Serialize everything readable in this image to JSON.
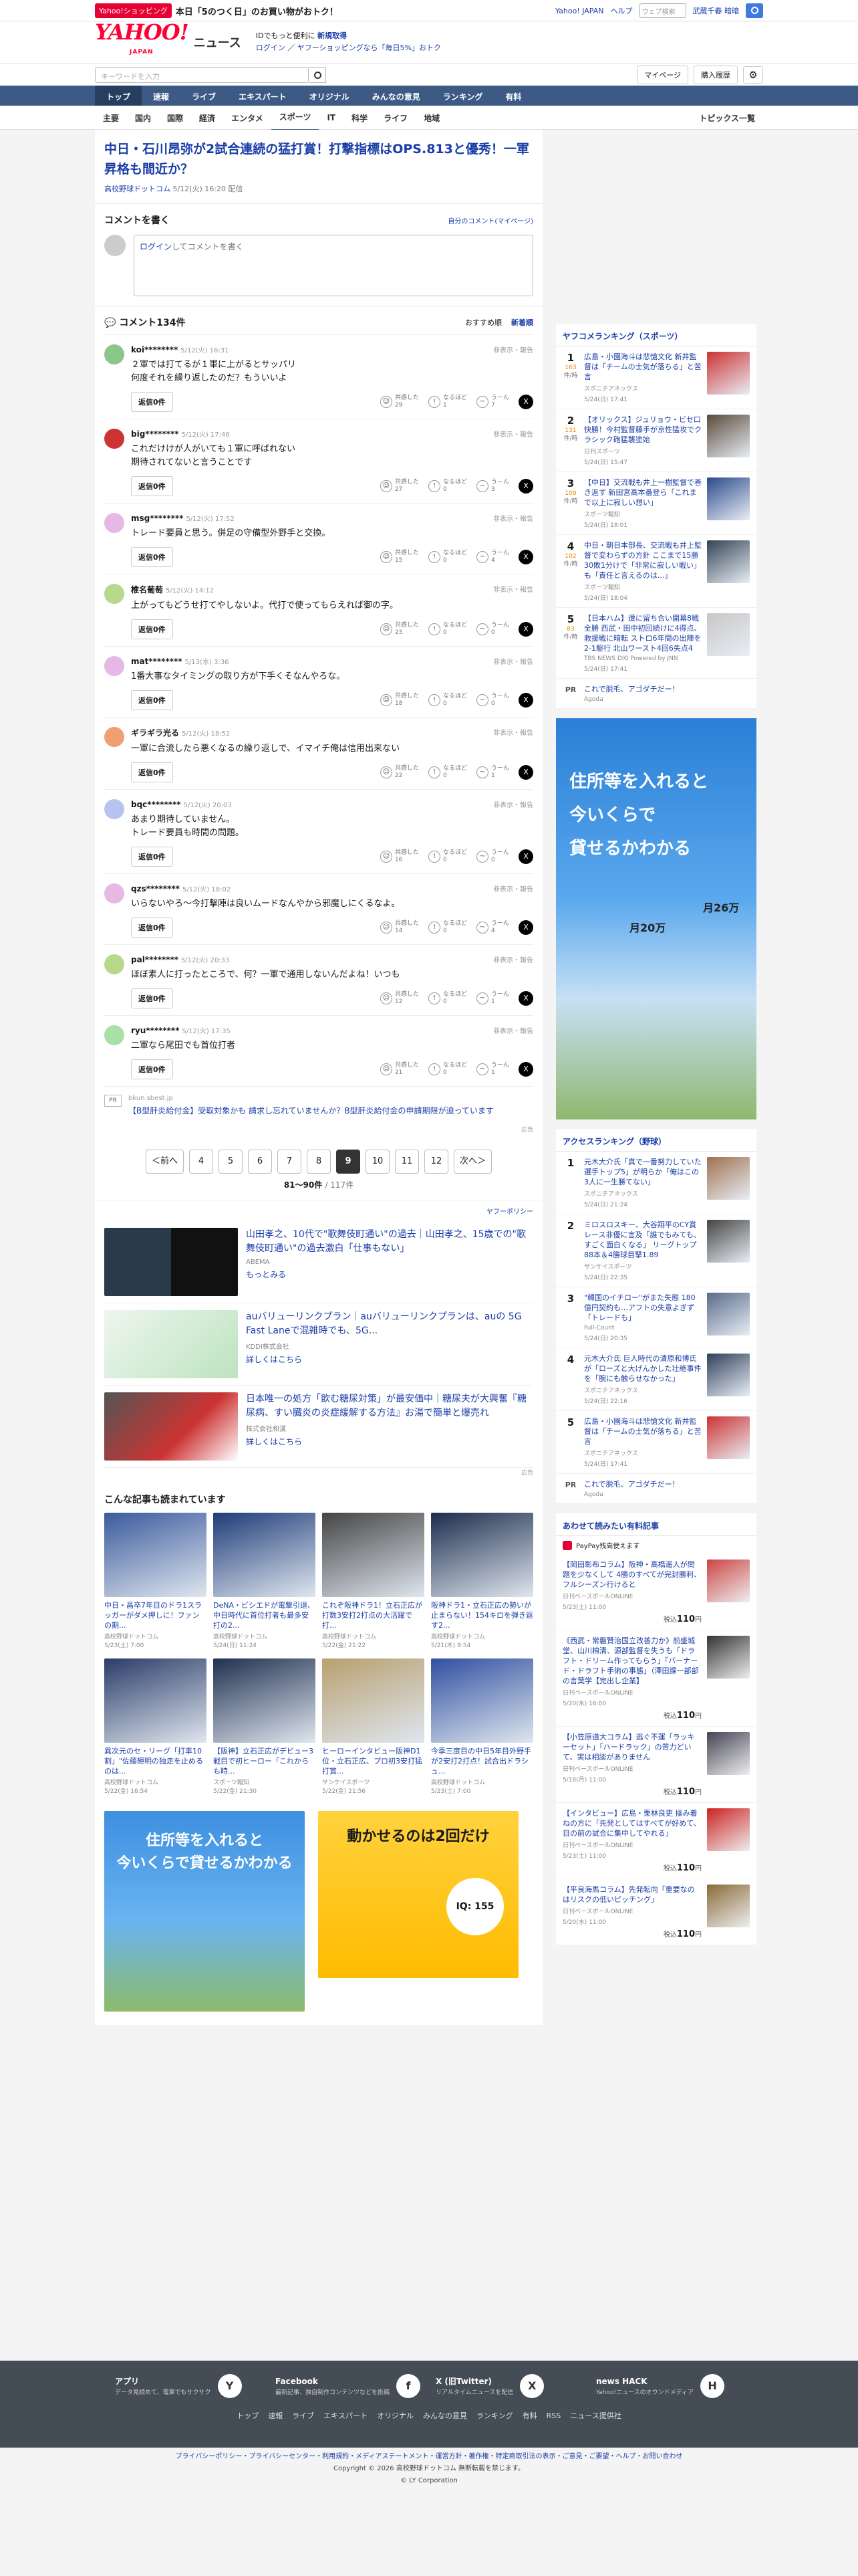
{
  "topbar": {
    "tag": "Yahoo!ショッピング",
    "promo": "本日「5のつく日」のお買い物がおトク！",
    "links": [
      "Yahoo! JAPAN",
      "ヘルプ"
    ],
    "web_placeholder": "ウェブ検索",
    "city": "武蔵千春 暗暗"
  },
  "header": {
    "logo": "YAHOO!",
    "logo_sub": "JAPAN",
    "title": "ニュース",
    "info1": "IDでもっと便利に",
    "info1b": "新規取得",
    "info2": "ログイン",
    "info2b": "ヤフーショッピングなら「毎日5%」おトク"
  },
  "search": {
    "placeholder": "キーワードを入力",
    "mypage": "マイページ",
    "history": "購入履歴"
  },
  "nav1": [
    "トップ",
    "速報",
    "ライブ",
    "エキスパート",
    "オリジナル",
    "みんなの意見",
    "ランキング",
    "有料"
  ],
  "nav2": [
    "主要",
    "国内",
    "国際",
    "経済",
    "エンタメ",
    "スポーツ",
    "IT",
    "科学",
    "ライフ",
    "地域"
  ],
  "nav2_topics": "トピックス一覧",
  "article": {
    "title": "中日・石川昂弥が2試合連続の猛打賞！打撃指標はOPS.813と優秀！一軍昇格も間近か？",
    "source": "高校野球ドットコム",
    "date": "5/12(火) 16:20 配信"
  },
  "comment_box": {
    "heading": "コメントを書く",
    "mine": "自分のコメント(マイページ)",
    "login": "ログイン",
    "placeholder": "してコメントを書く"
  },
  "comments_head": {
    "title": "コメント134件",
    "sort1": "おすすめ順",
    "sort2": "新着順"
  },
  "reply_label": "返信0件",
  "flag_label": "非表示・報告",
  "reactions": {
    "a": "共感した",
    "b": "なるほど",
    "c": "うーん"
  },
  "comments": [
    {
      "name": "koi********",
      "date": "5/12(火) 16:31",
      "text": "２軍では打てるが１軍に上がるとサッパリ\n何度それを繰り返したのだ？もういいよ",
      "a": "29",
      "b": "1",
      "c": "7",
      "color": "#8bc68b"
    },
    {
      "name": "big********",
      "date": "5/12(火) 17:46",
      "text": "これだけけが人がいても１軍に呼ばれない\n期待されてないと言うことです",
      "a": "27",
      "b": "0",
      "c": "3",
      "color": "#c33"
    },
    {
      "name": "msg********",
      "date": "5/12(火) 17:52",
      "text": "トレード要員と思う。併足の守備型外野手と交換。",
      "a": "15",
      "b": "0",
      "c": "4",
      "color": "#e6b8e6"
    },
    {
      "name": "椎名葡萄",
      "date": "5/12(火) 14:12",
      "text": "上がってもどうせ打てやしないよ。代打で使ってもらえれば御の字。",
      "a": "23",
      "b": "0",
      "c": "0",
      "color": "#b8d98b"
    },
    {
      "name": "mat********",
      "date": "5/13(水) 3:36",
      "text": "1番大事なタイミングの取り方が下手くそなんやろな。",
      "a": "18",
      "b": "0",
      "c": "0",
      "color": "#e6b8e6"
    },
    {
      "name": "ギラギラ光る",
      "date": "5/12(火) 18:52",
      "text": "一軍に合流したら悪くなるの繰り返しで、イマイチ俺は信用出来ない",
      "a": "22",
      "b": "0",
      "c": "1",
      "color": "#f0a070"
    },
    {
      "name": "bqc********",
      "date": "5/12(火) 20:03",
      "text": "あまり期待していません。\nトレード要員も時間の問題。",
      "a": "16",
      "b": "0",
      "c": "0",
      "color": "#b8c4f0"
    },
    {
      "name": "qzs********",
      "date": "5/12(火) 18:02",
      "text": "いらないやろ〜今打撃陣は良いムードなんやから邪魔しにくるなよ。",
      "a": "14",
      "b": "0",
      "c": "4",
      "color": "#e6b8e6"
    },
    {
      "name": "pal********",
      "date": "5/12(火) 20:33",
      "text": "ほぼ素人に打ったところで、何？一軍で通用しないんだよね！いつも",
      "a": "12",
      "b": "0",
      "c": "1",
      "color": "#b8d98b"
    },
    {
      "name": "ryu********",
      "date": "5/12(火) 17:35",
      "text": "二軍なら尾田でも首位打者",
      "a": "21",
      "b": "0",
      "c": "1",
      "color": "#a8e0a8"
    }
  ],
  "inline_ad": {
    "badge": "PR",
    "site": "bkun.sbest.jp",
    "title": "【B型肝炎給付金】受取対象かも 請求し忘れていませんか？B型肝炎給付金の申請期限が迫っています",
    "note": "広告"
  },
  "pager": {
    "prev": "＜前へ",
    "pages": [
      "4",
      "5",
      "6",
      "7",
      "8",
      "9",
      "10",
      "11",
      "12"
    ],
    "current": "9",
    "next": "次へ＞",
    "count": "81〜90件",
    "total": "/ 117件"
  },
  "promos": {
    "policy": "ヤフーポリシー",
    "items": [
      {
        "title": "山田孝之、10代で\"歌舞伎町通い\"の過去｜山田孝之、15歳での\"歌舞伎町通い\"の過去激白「仕事もない」",
        "src": "ABEMA",
        "more": "もっとみる"
      },
      {
        "title": "auバリューリンクプラン｜auバリューリンクプランは、auの 5G Fast Laneで混雑時でも、5G...",
        "src": "KDDI株式会社",
        "more": "詳しくはこちら"
      },
      {
        "title": "日本唯一の処方「飲む糖尿対策」が最安価中｜糖尿夫が大興奮『糖尿病、すい臓炎の炎症緩解する方法』お湯で簡単と爆売れ",
        "src": "株式会社和漢",
        "more": "詳しくはこちら"
      }
    ]
  },
  "related": {
    "heading": "こんな記事も読まれています",
    "items": [
      {
        "t": "中日・昌卒7年目のドラ1スラッガーがダメ押しに！ファンの期...",
        "s": "高校野球ドットコム",
        "d": "5/23(土) 7:00",
        "c": "#3a5a9c"
      },
      {
        "t": "DeNA・ビシエドが電撃引退、中日時代に首位打者も最多安打の2...",
        "s": "高校野球ドットコム",
        "d": "5/24(日) 11:24",
        "c": "#1e3c78"
      },
      {
        "t": "これぞ阪神ドラ1！立石正広が打数3安打2打点の大活躍で打...",
        "s": "高校野球ドットコム",
        "d": "5/22(金) 21:22",
        "c": "#444"
      },
      {
        "t": "阪神ドラ1・立石正広の勢いが止まらない！154キロを弾き返す2...",
        "s": "高校野球ドットコム",
        "d": "5/21(木) 9:54",
        "c": "#1c2c4c"
      },
      {
        "t": "異次元のセ・リーグ「打率10割」\"佐藤輝明の独走を止めるのは...",
        "s": "高校野球ドットコム",
        "d": "5/22(金) 16:54",
        "c": "#2a3c68"
      },
      {
        "t": "【阪神】立石正広がデビュー3戦目で初ヒーロー「これからも時...",
        "s": "スポーツ報知",
        "d": "5/22(金) 21:30",
        "c": "#203050"
      },
      {
        "t": "ヒーローインタビュー阪神D1位・立石正広、プロ初3安打猛打賞...",
        "s": "サンケイスポーツ",
        "d": "5/22(金) 21:56",
        "c": "#b8a070"
      },
      {
        "t": "今季三度目の中日5年目外野手が2安打2打点！試合出ドラシュ...",
        "s": "高校野球ドットコム",
        "d": "5/23(土) 7:00",
        "c": "#3050a0"
      }
    ]
  },
  "bottom_ads": {
    "a": "住所等を入れると\n今いくらで貸せるかわかる",
    "b": "動かせるのは2回だけ",
    "iq": "IQ: 155"
  },
  "rank1": {
    "title": "ヤフコメランキング（スポーツ）",
    "items": [
      {
        "no": "1",
        "cnt": "163",
        "unit": "件/時",
        "t": "広島・小園海斗は悲愴文化 新井監督は「チームの士気が落ちる」と苦言",
        "s": "スポニチアネックス",
        "d": "5/24(日) 17:41",
        "c": "#c33"
      },
      {
        "no": "2",
        "cnt": "131",
        "unit": "件/時",
        "t": "【オリックス】ジュリョウ・ビセ口快勝！今村監督藤手が京性猛攻でクラシック砲猛襲塗始",
        "s": "日刊スポーツ",
        "d": "5/24(日) 15:47",
        "c": "#5a4a3a"
      },
      {
        "no": "3",
        "cnt": "109",
        "unit": "件/時",
        "t": "【中日】交流戦も井上一樹監督で巻き返す 新田宮高本番登ら「これまで以上に寂しい想い」",
        "s": "スポーツ報知",
        "d": "5/24(日) 18:01",
        "c": "#2a4a8a"
      },
      {
        "no": "4",
        "cnt": "102",
        "unit": "件/時",
        "t": "中日・朝日本部長、交流戦も井上監督で変わらずの方針 ここまで15勝30敗1分けで「非常に寂しい戦い」も「責任と言えるのは…」",
        "s": "スポーツ報知",
        "d": "5/24(日) 18:04",
        "c": "#345"
      },
      {
        "no": "5",
        "cnt": "83",
        "unit": "件/時",
        "t": "【日本ハム】遭に留ち合い開幕8戦全勝 西武・田中初回続けに4得点、救援戦に暗転 ストロ6年間の出陣を2-1駆行 北山ワースト4回6失点4",
        "s": "TBS NEWS DIG Powered by JNN",
        "d": "5/24(日) 17:41",
        "c": "#c7c7c7"
      }
    ],
    "pr_label": "PR",
    "pr_title": "これで脱毛、アゴダチだー！",
    "pr_src": "Agoda"
  },
  "side_ad": {
    "title": "住所等を入れると\n今いくらで\n貸せるかわかる",
    "price1": "月20万",
    "price2": "月26万"
  },
  "rank2": {
    "title": "アクセスランキング（野球）",
    "items": [
      {
        "no": "1",
        "t": "元木大介氏「真で一番努力していた選手トップ5」が明らか「俺はこの3人に一生勝てない」",
        "s": "スポニチアネックス",
        "d": "5/24(日) 21:24",
        "c": "#a07050"
      },
      {
        "no": "2",
        "t": "ミロスロスキー、大谷翔平のCY賞レース非優に言及「誰でもみても、すごく面白くなる」 リーグトップ88本＆4勝球目撃1.89",
        "s": "サンケイスポーツ",
        "d": "5/24(日) 22:35",
        "c": "#444"
      },
      {
        "no": "3",
        "t": "\"韓国のイチロー\"がまた失態 180億円契約も…アフトの失意よぎず「トレードも」",
        "s": "Full-Count",
        "d": "5/24(日) 20:35",
        "c": "#5a6a8a"
      },
      {
        "no": "4",
        "t": "元木大介氏 巨人時代の清原和博氏が「ローズと大げんかした壮絶事件を「腕にも触らせなかった」",
        "s": "スポニチアネックス",
        "d": "5/24(日) 22:16",
        "c": "#30405a"
      },
      {
        "no": "5",
        "t": "広島・小園海斗は悲愴文化 新井監督は「チームの士気が落ちる」と苦言",
        "s": "スポニチアネックス",
        "d": "5/24(日) 17:41",
        "c": "#c33"
      }
    ],
    "pr_label": "PR",
    "pr_title": "これで脱毛、アゴダチだー！",
    "pr_src": "Agoda"
  },
  "paid": {
    "title": "あわせて読みたい有料記事",
    "pp": "PayPay残高使えます",
    "items": [
      {
        "t": "【岡田彰布コラム】阪神・高橋遥人が問題を少なくして 4勝のすべてが完封勝利、フルシーズン行けると",
        "s": "日刊ベースボールONLINE",
        "d": "5/23(土) 11:00",
        "price": "110",
        "c": "#c44"
      },
      {
        "t": "《西武・常磐賢治国立改善力か》前盛城堂、山川棉清、源部監督を失うも「ドラフト・ドリーム作ってもらう」「バーナード・ドラフト手術の事態」（澤田課一部部の言葉学【完出し企業】",
        "s": "日刊ベースボールONLINE",
        "d": "5/20(水) 16:00",
        "price": "110",
        "c": "#333"
      },
      {
        "t": "【小笠原道大コラム】逃ぐ不運「ラッキーセット」「ハードラック」の苦力どいて、実は相談がありません",
        "s": "日刊ベースボールONLINE",
        "d": "5/18(月) 11:00",
        "price": "110",
        "c": "#445"
      },
      {
        "t": "【インタビュー】広島・栗林良吏 操み着ねの方に「先発としてはすべてが好めて、目の前の試合に集中してやれる」",
        "s": "日刊ベースボールONLINE",
        "d": "5/23(土) 11:00",
        "price": "110",
        "c": "#c22"
      },
      {
        "t": "【平良海馬コラム】先発転向「重要なのはリスクの低いピッチング」",
        "s": "日刊ベースボールONLINE",
        "d": "5/20(水) 11:00",
        "price": "110",
        "c": "#8a6a3a"
      }
    ],
    "tax": "税込"
  },
  "footer": {
    "apps": [
      {
        "name": "アプリ",
        "desc": "データ見読めて、電車でもサクサク",
        "icon": "Y"
      },
      {
        "name": "Facebook",
        "desc": "最新記事、独自制作コンテンツなどを投稿",
        "icon": "f"
      },
      {
        "name": "X (旧Twitter)",
        "desc": "リアルタイムニュースを配信",
        "icon": "X"
      },
      {
        "name": "news HACK",
        "desc": "Yahoo!ニュースのオウンドメディア",
        "icon": "H"
      }
    ],
    "nav": [
      "トップ",
      "速報",
      "ライブ",
      "エキスパート",
      "オリジナル",
      "みんなの意見",
      "ランキング",
      "有料",
      "RSS",
      "ニュース提供社"
    ],
    "legal": "プライバシーポリシー・プライバシーセンター・利用規約・メディアステートメント・運営方針・著作権・特定商取引法の表示・ご意見・ご要望・ヘルプ・お問い合わせ",
    "copyright": "Copyright © 2026 高校野球ドットコム 無断転載を禁じます。",
    "corp": "© LY Corporation"
  }
}
